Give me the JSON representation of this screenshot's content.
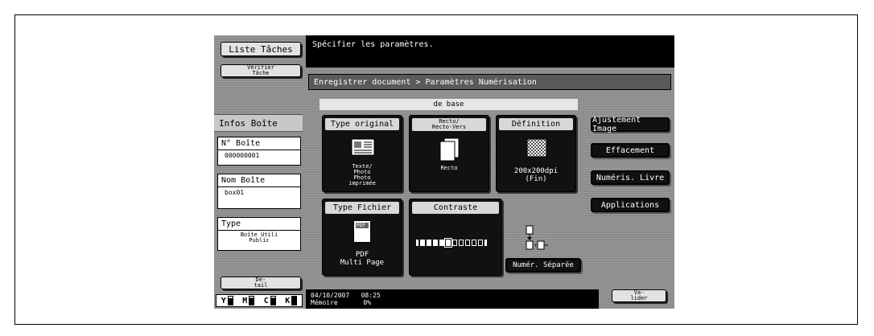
{
  "left": {
    "liste_taches": "Liste Tâches",
    "verifier_line1": "Vérifier",
    "verifier_line2": "Tâche",
    "infos_title": "Infos Boîte",
    "boite_label": "N° Boîte",
    "boite_value": "000000001",
    "nom_label": "Nom Boîte",
    "nom_value": "box01",
    "type_label": "Type",
    "type_value_line1": "Boîte Utili",
    "type_value_line2": "Public",
    "detail_line1": "Dé-",
    "detail_line2": "tail",
    "toner": [
      "Y",
      "M",
      "C",
      "K"
    ]
  },
  "header": {
    "message": "Spécifier les paramètres."
  },
  "breadcrumb": "Enregistrer document > Paramètres Numérisation",
  "section_title": "de base",
  "tiles": {
    "type_original": {
      "title": "Type original",
      "l1": "Texte/",
      "l2": "Photo",
      "l3": "Photo",
      "l4": "imprimée"
    },
    "recto_verso": {
      "title_l1": "Recto/",
      "title_l2": "Recto-Vers",
      "value": "Recto"
    },
    "definition": {
      "title": "Définition",
      "value_l1": "200x200dpi",
      "value_l2": "(Fin)"
    },
    "type_fichier": {
      "title": "Type Fichier",
      "badge": "PDF",
      "value_l1": "PDF",
      "value_l2": "Multi Page"
    },
    "contraste": {
      "title": "Contraste",
      "level": 5,
      "steps": 10
    }
  },
  "numer_separee": "Numér. Séparée",
  "right_buttons": {
    "ajustement": "Ajustement Image",
    "effacement": "Effacement",
    "numeris_livre": "Numéris. Livre",
    "applications": "Applications"
  },
  "footer": {
    "datetime": "04/10/2007   08:25",
    "memory_label": "Mémoire",
    "memory_value": "0%",
    "valider_line1": "Va-",
    "valider_line2": "lider"
  }
}
